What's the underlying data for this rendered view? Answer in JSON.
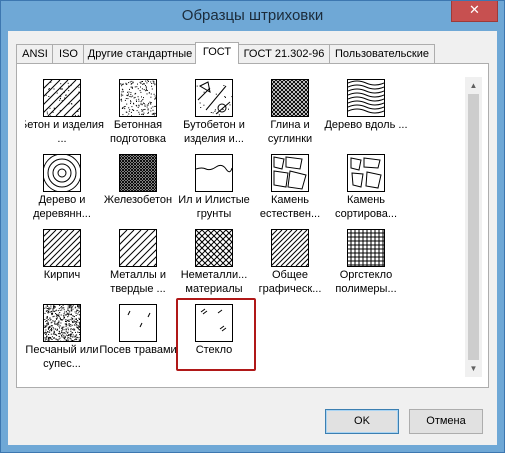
{
  "window": {
    "title": "Образцы штриховки",
    "close_glyph": "✕"
  },
  "tabs": [
    {
      "id": "ansi",
      "label": "ANSI",
      "active": false
    },
    {
      "id": "iso",
      "label": "ISO",
      "active": false
    },
    {
      "id": "other",
      "label": "Другие стандартные",
      "active": false
    },
    {
      "id": "gost",
      "label": "ГОСТ",
      "active": true
    },
    {
      "id": "gost21",
      "label": "ГОСТ 21.302-96",
      "active": false
    },
    {
      "id": "custom",
      "label": "Пользовательские",
      "active": false
    }
  ],
  "patterns": [
    {
      "label": "Бетон и изделия ...",
      "pattern": "concrete-pattern"
    },
    {
      "label": "Бетонная подготовка",
      "pattern": "concrete-base-pattern"
    },
    {
      "label": "Бутобетон и изделия и...",
      "pattern": "rubble-concrete-pattern"
    },
    {
      "label": "Глина и суглинки",
      "pattern": "clay-pattern"
    },
    {
      "label": "Дерево вдоль ...",
      "pattern": "wood-along-pattern"
    },
    {
      "label": "Дерево и деревянн...",
      "pattern": "wood-cross-pattern"
    },
    {
      "label": "Железобетон",
      "pattern": "reinforced-concrete-pattern"
    },
    {
      "label": "Ил и Илистые грунты",
      "pattern": "silt-pattern"
    },
    {
      "label": "Камень естествен...",
      "pattern": "natural-stone-pattern"
    },
    {
      "label": "Камень сортирова...",
      "pattern": "sorted-stone-pattern"
    },
    {
      "label": "Кирпич",
      "pattern": "brick-pattern"
    },
    {
      "label": "Металлы и твердые ...",
      "pattern": "metal-pattern"
    },
    {
      "label": "Неметалли... материалы",
      "pattern": "nonmetal-pattern"
    },
    {
      "label": "Общее графическ...",
      "pattern": "general-pattern"
    },
    {
      "label": "Оргстекло полимеры...",
      "pattern": "plexiglass-pattern"
    },
    {
      "label": "Песчаный или супес...",
      "pattern": "sand-pattern"
    },
    {
      "label": "Посев травами",
      "pattern": "grass-pattern"
    },
    {
      "label": "Стекло",
      "pattern": "glass-pattern",
      "selected": true
    }
  ],
  "buttons": {
    "ok": "OK",
    "cancel": "Отмена"
  },
  "colors": {
    "selection": "#b01818",
    "titlebar": "#6fa8d6",
    "close": "#c75050"
  }
}
